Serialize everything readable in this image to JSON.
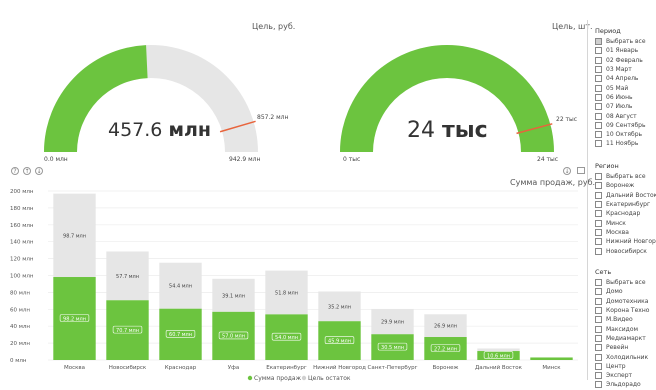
{
  "gauge_money": {
    "title": "Цель, руб.",
    "value_number": "457.6",
    "value_unit": "млн",
    "min_label": "0.0 млн",
    "max_label": "942.9 млн",
    "target_label": "857.2 млн",
    "value": 457.6,
    "max": 942.9,
    "target": 857.2
  },
  "gauge_count": {
    "title": "Цель, шт.",
    "value_number": "24",
    "value_unit": "тыс",
    "min_label": "0 тыс",
    "max_label": "24 тыс",
    "target_label": "22 тыс",
    "value": 24,
    "max": 24,
    "target": 22
  },
  "colors": {
    "green": "#6cc43f",
    "grey": "#e6e6e6",
    "target": "#e8643c"
  },
  "slicers": {
    "period": {
      "title": "Период",
      "select_all": "Выбрать все",
      "items": [
        "01 Январь",
        "02 Февраль",
        "03 Март",
        "04 Апрель",
        "05 Май",
        "06 Июнь",
        "07 Июль",
        "08 Август",
        "09 Сентябрь",
        "10 Октябрь",
        "11 Ноябрь"
      ]
    },
    "region": {
      "title": "Регион",
      "select_all": "Выбрать все",
      "items": [
        "Воронеж",
        "Дальний Восток",
        "Екатеринбург",
        "Краснодар",
        "Минск",
        "Москва",
        "Нижний Новгор...",
        "Новосибирск"
      ]
    },
    "network": {
      "title": "Сеть",
      "select_all": "Выбрать все",
      "items": [
        "Домо",
        "Домотехника",
        "Корона Техно",
        "М.Видео",
        "Максидом",
        "Медиамаркт",
        "Ревейн",
        "Холодильник",
        "Центр",
        "Эксперт",
        "Эльдорадо"
      ]
    }
  },
  "toolbar_icons": [
    "help-icon",
    "drill-up-icon",
    "drill-down-icon"
  ],
  "chart_data": {
    "type": "bar",
    "title": "Сумма продаж, руб.",
    "categories": [
      "Москва",
      "Новосибирск",
      "Краснодар",
      "Уфа",
      "Екатеринбург",
      "Нижний Новгород",
      "Санкт-Петербург",
      "Воронеж",
      "Дальний Восток",
      "Минск"
    ],
    "series": [
      {
        "name": "Сумма продаж",
        "values": [
          98.2,
          70.7,
          60.7,
          57.0,
          54.0,
          45.9,
          30.5,
          27.2,
          10.6,
          3.0
        ],
        "labels": [
          "98.2 млн",
          "70.7 млн",
          "60.7 млн",
          "57.0 млн",
          "54.0 млн",
          "45.9 млн",
          "30.5 млн",
          "27.2 млн",
          "10.6 млн",
          ""
        ]
      },
      {
        "name": "Цель остаток",
        "values": [
          98.7,
          57.7,
          54.4,
          39.1,
          51.8,
          35.2,
          29.9,
          26.9,
          3.0,
          0
        ],
        "labels": [
          "98.7 млн",
          "57.7 млн",
          "54.4 млн",
          "39.1 млн",
          "51.8 млн",
          "35.2 млн",
          "29.9 млн",
          "26.9 млн",
          "",
          ""
        ]
      }
    ],
    "y_ticks": [
      "0 млн",
      "20 млн",
      "40 млн",
      "60 млн",
      "80 млн",
      "100 млн",
      "120 млн",
      "140 млн",
      "160 млн",
      "180 млн",
      "200 млн"
    ],
    "ylim": [
      0,
      200
    ],
    "grid": true,
    "legend_position": "bottom-center",
    "colors": [
      "#6cc43f",
      "#e6e6e6"
    ]
  }
}
